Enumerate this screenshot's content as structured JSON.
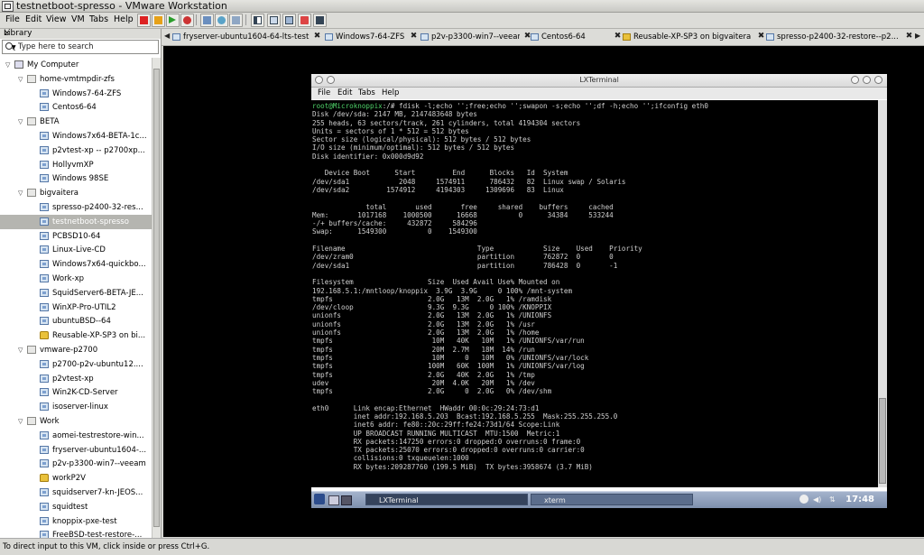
{
  "window": {
    "title": "testnetboot-spresso - VMware Workstation"
  },
  "menubar": {
    "items": [
      "File",
      "Edit",
      "View",
      "VM",
      "Tabs",
      "Help"
    ]
  },
  "library": {
    "header": "Library",
    "close_glyph": "×",
    "search_placeholder": "Type here to search",
    "tree": [
      {
        "label": "My Computer",
        "level": 0,
        "icon": "computer-icon",
        "expanded": true
      },
      {
        "label": "home-vmtmpdir-zfs",
        "level": 1,
        "icon": "folder-icon",
        "expanded": true
      },
      {
        "label": "Windows7-64-ZFS",
        "level": 2,
        "icon": "vm-icon"
      },
      {
        "label": "Centos6-64",
        "level": 2,
        "icon": "vm-icon"
      },
      {
        "label": "BETA",
        "level": 1,
        "icon": "folder-icon",
        "expanded": true
      },
      {
        "label": "Windows7x64-BETA-1c...",
        "level": 2,
        "icon": "vm-icon"
      },
      {
        "label": "p2vtest-xp -- p2700xp...",
        "level": 2,
        "icon": "vm-icon"
      },
      {
        "label": "HollyvmXP",
        "level": 2,
        "icon": "vm-icon"
      },
      {
        "label": "Windows 98SE",
        "level": 2,
        "icon": "vm-icon"
      },
      {
        "label": "bigvaitera",
        "level": 1,
        "icon": "folder-icon",
        "expanded": true
      },
      {
        "label": "spresso-p2400-32-res...",
        "level": 2,
        "icon": "vm-icon"
      },
      {
        "label": "testnetboot-spresso",
        "level": 2,
        "icon": "vm-icon",
        "selected": true
      },
      {
        "label": "PCBSD10-64",
        "level": 2,
        "icon": "vm-icon"
      },
      {
        "label": "Linux-Live-CD",
        "level": 2,
        "icon": "vm-icon"
      },
      {
        "label": "Windows7x64-quickbo...",
        "level": 2,
        "icon": "vm-icon"
      },
      {
        "label": "Work-xp",
        "level": 2,
        "icon": "vm-icon"
      },
      {
        "label": "SquidServer6-BETA-JE...",
        "level": 2,
        "icon": "vm-icon"
      },
      {
        "label": "WinXP-Pro-UTIL2",
        "level": 2,
        "icon": "vm-icon"
      },
      {
        "label": "ubuntuBSD--64",
        "level": 2,
        "icon": "vm-icon"
      },
      {
        "label": "Reusable-XP-SP3 on bi...",
        "level": 2,
        "icon": "lock-icon"
      },
      {
        "label": "vmware-p2700",
        "level": 1,
        "icon": "folder-icon",
        "expanded": true
      },
      {
        "label": "p2700-p2v-ubuntu12....",
        "level": 2,
        "icon": "vm-icon"
      },
      {
        "label": "p2vtest-xp",
        "level": 2,
        "icon": "vm-icon"
      },
      {
        "label": "Win2K-CD-Server",
        "level": 2,
        "icon": "vm-icon"
      },
      {
        "label": "isoserver-linux",
        "level": 2,
        "icon": "vm-icon"
      },
      {
        "label": "Work",
        "level": 1,
        "icon": "folder-icon",
        "expanded": true
      },
      {
        "label": "aomei-testrestore-win...",
        "level": 2,
        "icon": "vm-icon"
      },
      {
        "label": "fryserver-ubuntu1604-...",
        "level": 2,
        "icon": "vm-icon"
      },
      {
        "label": "p2v-p3300-win7--veeam",
        "level": 2,
        "icon": "vm-icon"
      },
      {
        "label": "workP2V",
        "level": 2,
        "icon": "lock-icon"
      },
      {
        "label": "squidserver7-kn-JEOS...",
        "level": 2,
        "icon": "vm-icon"
      },
      {
        "label": "squidtest",
        "level": 2,
        "icon": "vm-icon"
      },
      {
        "label": "knoppix-pxe-test",
        "level": 2,
        "icon": "vm-icon"
      },
      {
        "label": "FreeBSD-test-restore-...",
        "level": 2,
        "icon": "vm-icon"
      }
    ]
  },
  "tabs": {
    "prev_glyph": "◀",
    "next_glyph": "▶",
    "close_glyph": "✖",
    "items": [
      {
        "label": "fryserver-ubuntu1604-64-lts-test",
        "icon": "vm-icon"
      },
      {
        "label": "Windows7-64-ZFS",
        "icon": "vm-icon"
      },
      {
        "label": "p2v-p3300-win7--veeam",
        "icon": "vm-icon"
      },
      {
        "label": "Centos6-64",
        "icon": "vm-icon"
      },
      {
        "label": "Reusable-XP-SP3 on bigvaitera",
        "icon": "lock-icon"
      },
      {
        "label": "spresso-p2400-32-restore--p2...",
        "icon": "vm-icon"
      }
    ]
  },
  "terminal": {
    "window_title": "LXTerminal",
    "menu": [
      "File",
      "Edit",
      "Tabs",
      "Help"
    ],
    "prompt_user": "root@Microknoppix",
    "prompt_rest": ":/# fdisk -l;echo '';free;echo '';swapon -s;echo '';df -h;echo '';ifconfig eth0",
    "output": "\nDisk /dev/sda: 2147 MB, 2147483648 bytes\n255 heads, 63 sectors/track, 261 cylinders, total 4194304 sectors\nUnits = sectors of 1 * 512 = 512 bytes\nSector size (logical/physical): 512 bytes / 512 bytes\nI/O size (minimum/optimal): 512 bytes / 512 bytes\nDisk identifier: 0x000d9d92\n\n   Device Boot      Start         End      Blocks   Id  System\n/dev/sda1            2048     1574911      786432   82  Linux swap / Solaris\n/dev/sda2         1574912     4194303     1309696   83  Linux\n\n             total       used       free     shared    buffers     cached\nMem:       1017168    1000500      16668          0      34384     533244\n-/+ buffers/cache:     432872     584296\nSwap:      1549300          0    1549300\n\nFilename                                Type            Size    Used    Priority\n/dev/zram0                              partition       762872  0       0\n/dev/sda1                               partition       786428  0       -1\n\nFilesystem                  Size  Used Avail Use% Mounted on\n192.168.5.1:/mntloop/knoppix  3.9G  3.9G     0 100% /mnt-system\ntmpfs                       2.0G   13M  2.0G   1% /ramdisk\n/dev/cloop                  9.3G  9.3G     0 100% /KNOPPIX\nunionfs                     2.0G   13M  2.0G   1% /UNIONFS\nunionfs                     2.0G   13M  2.0G   1% /usr\nunionfs                     2.0G   13M  2.0G   1% /home\ntmpfs                        10M   40K   10M   1% /UNIONFS/var/run\ntmpfs                        20M  2.7M   18M  14% /run\ntmpfs                        10M     0   10M   0% /UNIONFS/var/lock\ntmpfs                       100M   60K  100M   1% /UNIONFS/var/log\ntmpfs                       2.0G   40K  2.0G   1% /tmp\nudev                         20M  4.0K   20M   1% /dev\ntmpfs                       2.0G     0  2.0G   0% /dev/shm\n\neth0      Link encap:Ethernet  HWaddr 00:0c:29:24:73:d1\n          inet addr:192.168.5.203  Bcast:192.168.5.255  Mask:255.255.255.0\n          inet6 addr: fe80::20c:29ff:fe24:73d1/64 Scope:Link\n          UP BROADCAST RUNNING MULTICAST  MTU:1500  Metric:1\n          RX packets:147250 errors:0 dropped:0 overruns:0 frame:0\n          TX packets:25070 errors:0 dropped:0 overruns:0 carrier:0\n          collisions:0 txqueuelen:1000\n          RX bytes:209287760 (199.5 MiB)  TX bytes:3958674 (3.7 MiB)"
  },
  "guest_panel": {
    "tasks": [
      "LXTerminal",
      "xterm"
    ],
    "clock": "17:48"
  },
  "statusbar": {
    "text": "To direct input to this VM, click inside or press Ctrl+G."
  },
  "colors": {
    "vm_background": "#000000",
    "selection": "#b5b5b0",
    "prompt_green": "#4fd36a",
    "guest_panel": "#8a9bb7"
  }
}
